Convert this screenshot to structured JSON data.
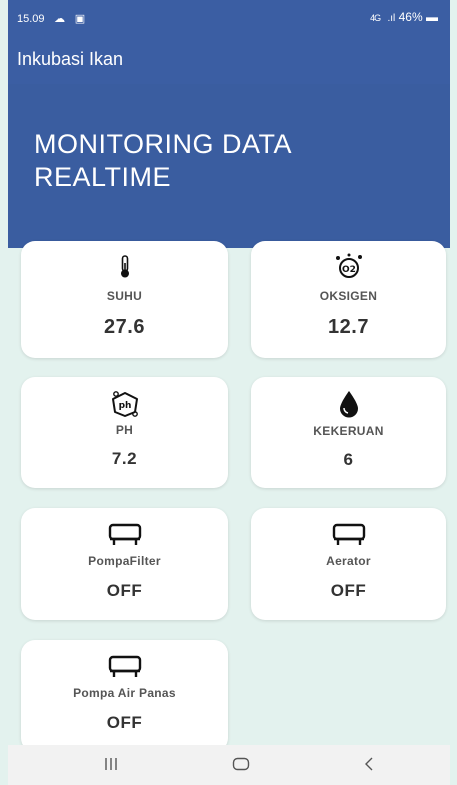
{
  "status": {
    "time": "15.09",
    "network": "4G",
    "battery": "46%"
  },
  "appbar": {
    "title": "Inkubasi Ikan"
  },
  "hero": {
    "line1": "MONITORING DATA",
    "line2": "REALTIME"
  },
  "cards": {
    "suhu": {
      "label": "SUHU",
      "value": "27.6",
      "icon": "thermometer-icon"
    },
    "oksigen": {
      "label": "OKSIGEN",
      "value": "12.7",
      "icon": "oxygen-icon"
    },
    "ph": {
      "label": "PH",
      "value": "7.2",
      "icon": "ph-icon"
    },
    "kekeruan": {
      "label": "KEKERUAN",
      "value": "6",
      "icon": "water-drop-icon"
    },
    "pompa_filter": {
      "label": "PompaFilter",
      "value": "OFF",
      "icon": "pump-icon"
    },
    "aerator": {
      "label": "Aerator",
      "value": "OFF",
      "icon": "pump-icon"
    },
    "pompa_air_panas": {
      "label": "Pompa Air Panas",
      "value": "OFF",
      "icon": "pump-icon"
    }
  },
  "navbar": {
    "recent": "recent-apps-icon",
    "home": "home-icon",
    "back": "back-icon"
  },
  "colors": {
    "header": "#3b5ea3",
    "background": "#e3f2ee",
    "card": "#ffffff"
  }
}
